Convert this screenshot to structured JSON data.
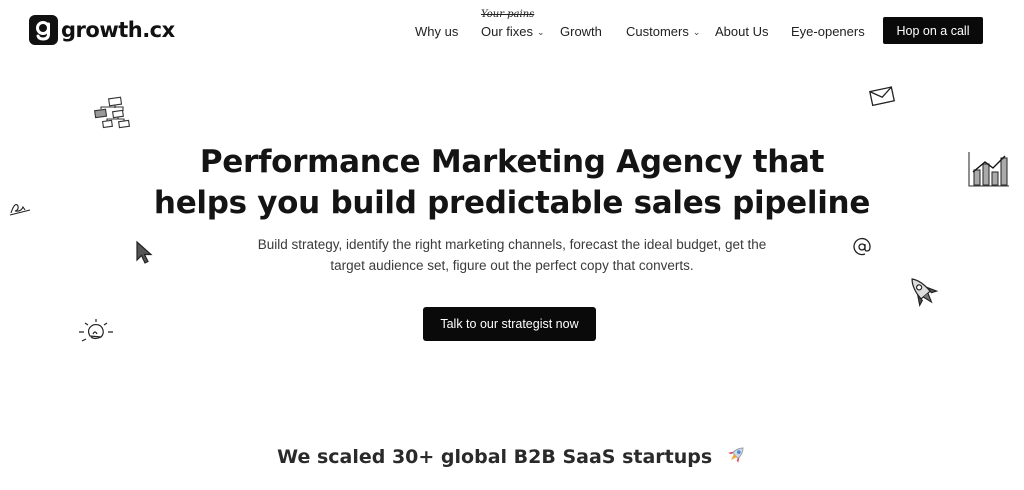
{
  "brand": {
    "name": "growth.cx"
  },
  "nav": {
    "items": [
      {
        "label": "Why us",
        "has_dropdown": false
      },
      {
        "label": "Our fixes",
        "has_dropdown": true,
        "note": "Your pains"
      },
      {
        "label": "Growth",
        "has_dropdown": false
      },
      {
        "label": "Customers",
        "has_dropdown": true
      },
      {
        "label": "About Us",
        "has_dropdown": false
      },
      {
        "label": "Eye-openers",
        "has_dropdown": false
      }
    ],
    "cta_label": "Hop on a call"
  },
  "hero": {
    "title_line1": "Performance Marketing Agency that",
    "title_line2": "helps you build predictable sales pipeline",
    "subtitle_line1": "Build strategy, identify the right marketing channels, forecast the ideal budget, get the",
    "subtitle_line2": "target audience set, figure out the perfect copy that converts.",
    "cta_label": "Talk to our strategist now"
  },
  "proof": {
    "text": "We scaled 30+ global B2B SaaS startups"
  },
  "doodles": [
    "flowchart-icon",
    "envelope-icon",
    "bar-chart-icon",
    "signature-icon",
    "cursor-icon",
    "at-sign-icon",
    "rocket-icon",
    "lightbulb-icon"
  ],
  "colors": {
    "background": "#ffffff",
    "text": "#141414",
    "button": "#0a0a0a",
    "button_text": "#ffffff",
    "rocket_accent": "#e0405a"
  }
}
